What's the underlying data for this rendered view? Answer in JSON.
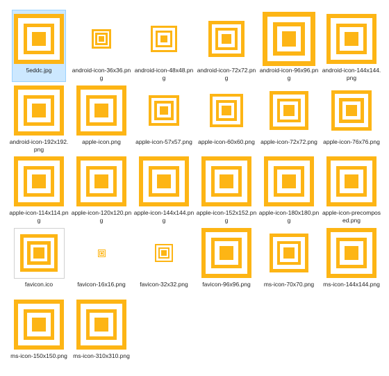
{
  "colors": {
    "accent": "#fdb515",
    "white": "#ffffff",
    "selection": "#cce8ff"
  },
  "files": [
    {
      "name": "5eddc.jpg",
      "icon": "square-logo-icon",
      "selected": true
    },
    {
      "name": "android-icon-36x36.png",
      "icon": "square-logo-icon"
    },
    {
      "name": "android-icon-48x48.png",
      "icon": "square-logo-icon"
    },
    {
      "name": "android-icon-72x72.png",
      "icon": "square-logo-icon"
    },
    {
      "name": "android-icon-96x96.png",
      "icon": "square-logo-icon"
    },
    {
      "name": "android-icon-144x144.png",
      "icon": "square-logo-icon"
    },
    {
      "name": "android-icon-192x192.png",
      "icon": "square-logo-icon"
    },
    {
      "name": "apple-icon.png",
      "icon": "square-logo-icon"
    },
    {
      "name": "apple-icon-57x57.png",
      "icon": "square-logo-icon"
    },
    {
      "name": "apple-icon-60x60.png",
      "icon": "square-logo-icon"
    },
    {
      "name": "apple-icon-72x72.png",
      "icon": "square-logo-icon"
    },
    {
      "name": "apple-icon-76x76.png",
      "icon": "square-logo-icon"
    },
    {
      "name": "apple-icon-114x114.png",
      "icon": "square-logo-icon"
    },
    {
      "name": "apple-icon-120x120.png",
      "icon": "square-logo-icon"
    },
    {
      "name": "apple-icon-144x144.png",
      "icon": "square-logo-icon"
    },
    {
      "name": "apple-icon-152x152.png",
      "icon": "square-logo-icon"
    },
    {
      "name": "apple-icon-180x180.png",
      "icon": "square-logo-icon"
    },
    {
      "name": "apple-icon-precomposed.png",
      "icon": "square-logo-icon"
    },
    {
      "name": "favicon.ico",
      "icon": "square-logo-icon"
    },
    {
      "name": "favicon-16x16.png",
      "icon": "square-logo-icon"
    },
    {
      "name": "favicon-32x32.png",
      "icon": "square-logo-icon"
    },
    {
      "name": "favicon-96x96.png",
      "icon": "square-logo-icon"
    },
    {
      "name": "ms-icon-70x70.png",
      "icon": "square-logo-icon"
    },
    {
      "name": "ms-icon-144x144.png",
      "icon": "square-logo-icon"
    },
    {
      "name": "ms-icon-150x150.png",
      "icon": "square-logo-icon"
    },
    {
      "name": "ms-icon-310x310.png",
      "icon": "square-logo-icon"
    }
  ]
}
